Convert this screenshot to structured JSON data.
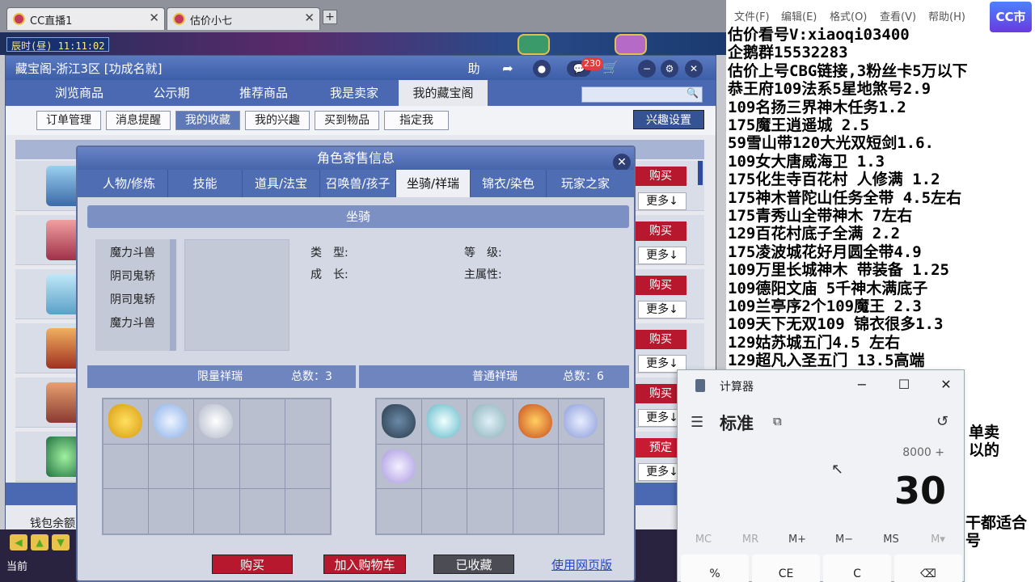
{
  "browser_tabs": [
    {
      "label": "CC直播1"
    },
    {
      "label": "估价小七"
    }
  ],
  "game": {
    "clock": "辰时(昼)  11:11:02",
    "current": "当前"
  },
  "cbg": {
    "title": "藏宝阁-浙江3区 [功成名就]",
    "help": "助",
    "cart_badge": "230",
    "nav": [
      "浏览商品",
      "公示期",
      "推荐商品",
      "我是卖家",
      "我的藏宝阁"
    ],
    "subnav": [
      "订单管理",
      "消息提醒",
      "我的收藏",
      "我的兴趣",
      "买到物品",
      "指定我"
    ],
    "interest_settings": "兴趣设置",
    "row_buttons": [
      "购买",
      "购买",
      "购买",
      "购买",
      "购买",
      "预定"
    ],
    "more_label": "更多↓",
    "wallet": "钱包余额"
  },
  "dialog": {
    "title": "角色寄售信息",
    "tabs": [
      "人物/修炼",
      "技能",
      "道具/法宝",
      "召唤兽/孩子",
      "坐骑/祥瑞",
      "锦衣/染色",
      "玩家之家"
    ],
    "section": "坐骑",
    "mounts": [
      "魔力斗兽",
      "阴司鬼轿",
      "阴司鬼轿",
      "魔力斗兽"
    ],
    "labels": {
      "type": "类　型:",
      "grade": "等　级:",
      "growth": "成　长:",
      "attr": "主属性:"
    },
    "limited": {
      "name": "限量祥瑞",
      "total": "总数：3"
    },
    "normal": {
      "name": "普通祥瑞",
      "total": "总数：6"
    },
    "buttons": {
      "buy": "购买",
      "add_cart": "加入购物车",
      "collected": "已收藏",
      "web": "使用网页版"
    }
  },
  "notes": {
    "menu": [
      "文件(F)",
      "编辑(E)",
      "格式(O)",
      "查看(V)",
      "帮助(H)"
    ],
    "logo": "CC市播",
    "lines": [
      "估价看号V:xiaoqi03400",
      "企鹅群15532283",
      "估价上号CBG链接,3粉丝卡5万以下",
      "恭王府109法系5星地煞号2.9",
      "109名扬三界神木任务1.2",
      "175魔王逍遥城 2.5",
      "59雪山带120大光双短剑1.6.",
      "109女大唐威海卫  1.3",
      "175化生寺百花村 人修满 1.2",
      "175神木普陀山任务全带 4.5左右",
      "175青秀山全带神木   7左右",
      "129百花村底子全满 2.2",
      "175凌波城花好月圆全带4.9",
      "109万里长城神木 带装备  1.25",
      "109德阳文庙 5千神木满底子",
      "109兰亭序2个109魔王 2.3",
      "109天下无双109  锦衣很多1.3",
      "129姑苏城五门4.5 左右",
      "129超凡入圣五门  13.5高端"
    ],
    "partial": [
      "单卖",
      "以的",
      "干都适合",
      "号"
    ]
  },
  "calculator": {
    "title": "计算器",
    "mode": "标准",
    "expression": "8000 +",
    "display": "30",
    "memory": [
      "MC",
      "MR",
      "M+",
      "M−",
      "MS",
      "M▾"
    ],
    "keys": [
      "%",
      "CE",
      "C",
      "⌫"
    ]
  }
}
